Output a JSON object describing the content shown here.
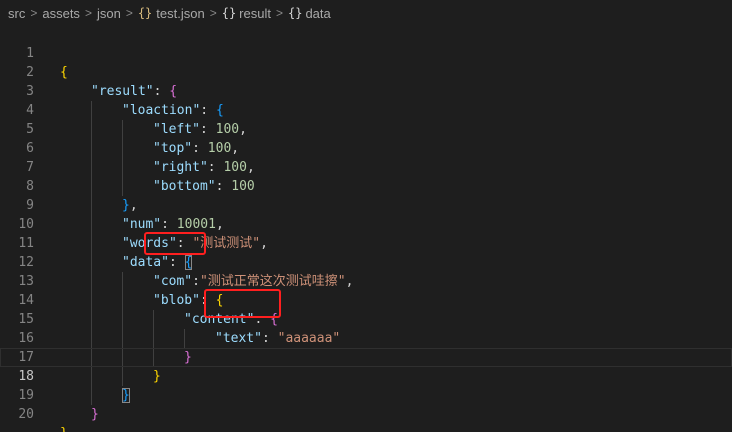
{
  "breadcrumb": {
    "items": [
      "src",
      "assets",
      "json",
      "test.json",
      "result",
      "data"
    ],
    "brace_icon": "{}",
    "separator": ">"
  },
  "lines": [
    {
      "n": "1"
    },
    {
      "n": "2"
    },
    {
      "n": "3"
    },
    {
      "n": "4"
    },
    {
      "n": "5"
    },
    {
      "n": "6"
    },
    {
      "n": "7"
    },
    {
      "n": "8"
    },
    {
      "n": "9"
    },
    {
      "n": "10"
    },
    {
      "n": "11"
    },
    {
      "n": "12"
    },
    {
      "n": "13"
    },
    {
      "n": "14"
    },
    {
      "n": "15"
    },
    {
      "n": "16"
    },
    {
      "n": "17"
    },
    {
      "n": "18"
    },
    {
      "n": "19"
    },
    {
      "n": "20"
    }
  ],
  "code": {
    "open_brace": "{",
    "close_brace": "}",
    "close_brace_comma": "},",
    "result_key": "\"result\"",
    "loaction_key": "\"loaction\"",
    "left_key": "\"left\"",
    "left_val": "100",
    "top_key": "\"top\"",
    "top_val": "100",
    "right_key": "\"right\"",
    "right_val": "100",
    "bottom_key": "\"bottom\"",
    "bottom_val": "100",
    "num_key": "\"num\"",
    "num_val": "10001",
    "words_key": "\"words\"",
    "words_val": "\"测试测试\"",
    "data_key": "\"data\"",
    "com_key": "\"com\"",
    "com_val": "\"测试正常这次测试哇擦\"",
    "blob_key": "\"blob\"",
    "content_key": "\"content\"",
    "text_key": "\"text\"",
    "text_val": "\"aaaaaa\""
  },
  "current_line": "18",
  "colors": {
    "background": "#1e1e1e",
    "key": "#9cdcfe",
    "number": "#b5cea8",
    "string": "#ce9178",
    "annotation_box": "#ff1f1f"
  }
}
